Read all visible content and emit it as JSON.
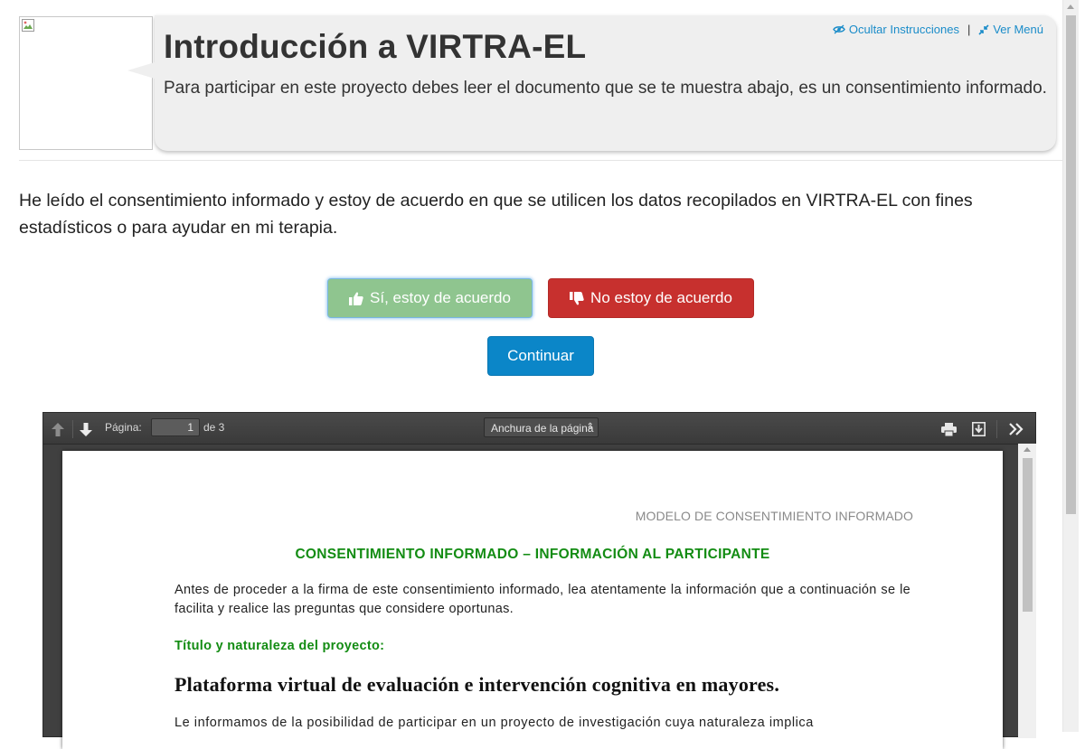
{
  "header": {
    "title": "Introducción a VIRTRA-EL",
    "intro": "Para participar en este proyecto debes leer el documento que se te muestra abajo, es un consentimiento informado.",
    "avatar_icon": "broken-image-icon",
    "links": {
      "hide_instructions": "Ocultar Instrucciones",
      "separator": "|",
      "view_menu": "Ver Menú",
      "hide_icon": "eye-slash-icon",
      "menu_icon": "compress-icon"
    }
  },
  "consent": {
    "statement": "He leído el consentimiento informado y estoy de acuerdo en que se utilicen los datos recopilados en VIRTRA-EL con fines estadísticos o para ayudar en mi terapia."
  },
  "buttons": {
    "agree": "Sí, estoy de acuerdo",
    "agree_icon": "thumbs-up-icon",
    "disagree": "No estoy de acuerdo",
    "disagree_icon": "thumbs-down-icon",
    "continue": "Continuar"
  },
  "colors": {
    "agree_bg": "#8fc58f",
    "disagree_bg": "#c7302e",
    "continue_bg": "#0b86c8",
    "link": "#1a8cc9",
    "doc_green": "#138c13"
  },
  "viewer": {
    "page_label": "Página:",
    "page_value": "1",
    "page_total": "de 3",
    "zoom_value": "Anchura de la página",
    "toolbar_icons": [
      "arrow-up-icon",
      "arrow-down-icon",
      "print-icon",
      "download-icon",
      "double-chevron-right-icon"
    ]
  },
  "document": {
    "header": "MODELO DE CONSENTIMIENTO INFORMADO",
    "title": "CONSENTIMIENTO INFORMADO – INFORMACIÓN AL PARTICIPANTE",
    "intro": "Antes de proceder a la firma de este consentimiento informado, lea atentamente la información que a continuación se le facilita y realice las preguntas que considere oportunas.",
    "subheading": "Título y naturaleza del proyecto:",
    "project_title": "Plataforma virtual de evaluación e intervención cognitiva en mayores.",
    "body": "Le informamos de la posibilidad de participar en un proyecto de investigación cuya naturaleza implica"
  }
}
